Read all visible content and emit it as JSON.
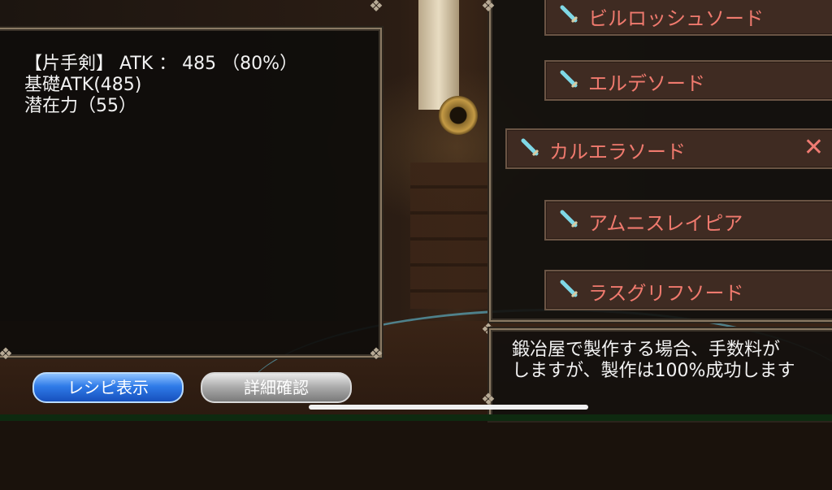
{
  "info": {
    "line1": "【片手剣】 ATK ： 485 （80%）",
    "line2": "基礎ATK(485)",
    "line3": "潜在力（55）"
  },
  "recipes": [
    {
      "label": "ビルロッシュソード",
      "selected": false
    },
    {
      "label": "エルデソード",
      "selected": false
    },
    {
      "label": "カルエラソード",
      "selected": true,
      "close": "✕"
    },
    {
      "label": "アムニスレイピア",
      "selected": false
    },
    {
      "label": "ラスグリフソード",
      "selected": false
    }
  ],
  "description": {
    "line1": "鍛冶屋で製作する場合、手数料が",
    "line2": "しますが、製作は100%成功します"
  },
  "buttons": {
    "recipe": "レシピ表示",
    "detail": "詳細確認"
  },
  "colors": {
    "item_text": "#f07a6e",
    "panel_bg": "#0f0d0b",
    "blue_button": "#2f7be8"
  }
}
